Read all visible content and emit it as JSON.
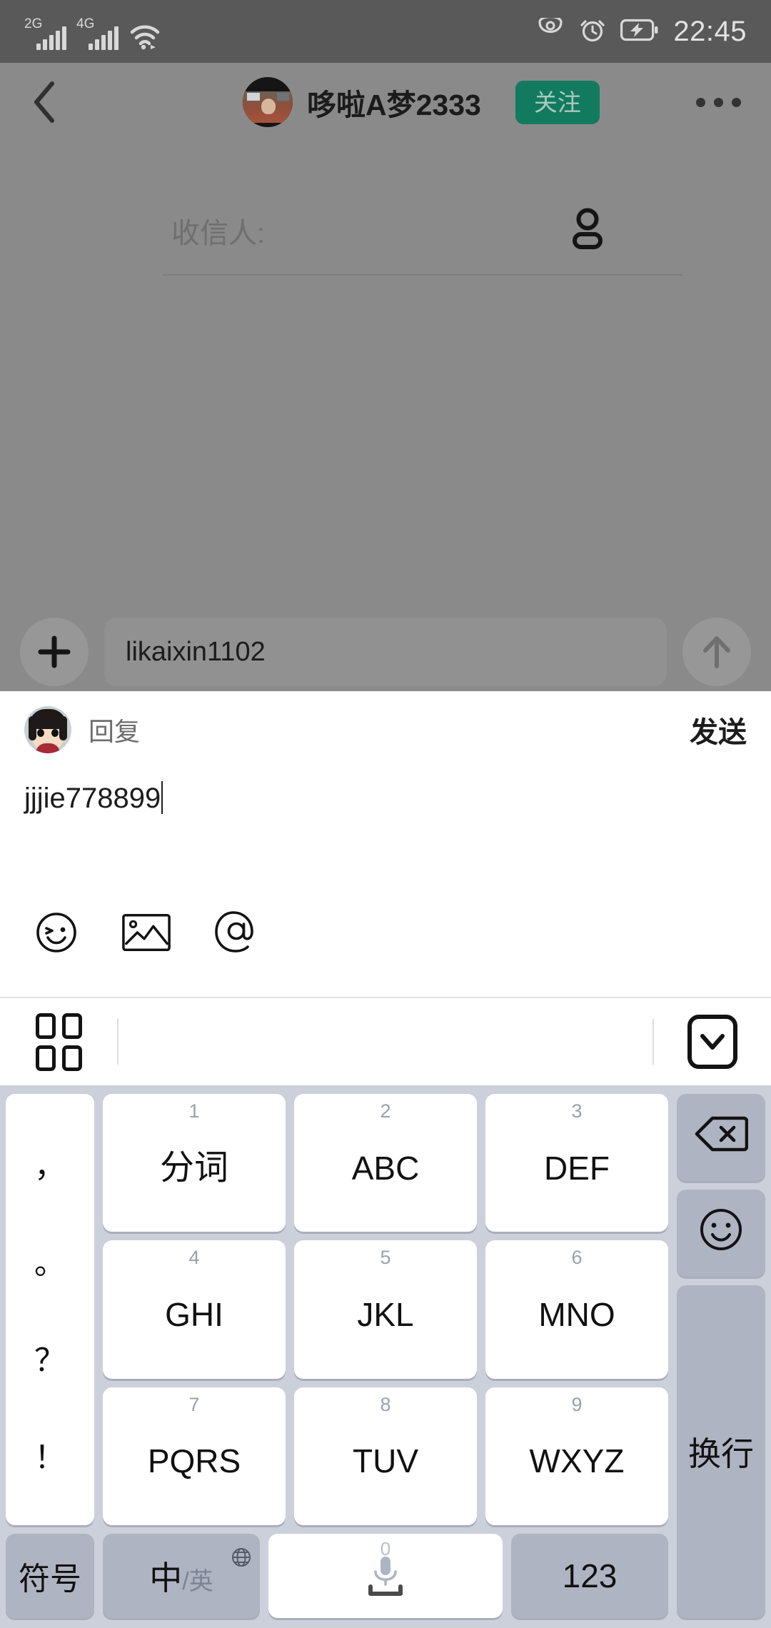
{
  "status_bar": {
    "network_1": "2G",
    "network_2": "4G",
    "wifi_icon": "wifi-icon",
    "eye_icon": "eye-icon",
    "alarm_icon": "alarm-clock-icon",
    "battery_icon": "battery-charging-icon",
    "time": "22:45"
  },
  "background_page": {
    "back_icon": "back-chevron-icon",
    "avatar": "user-avatar",
    "title": "哆啦A梦2333",
    "follow_label": "关注",
    "more_icon": "more-options-icon",
    "recipient_label": "收信人:",
    "recipient_person_icon": "person-icon",
    "composer": {
      "plus_icon": "plus-icon",
      "input_value": "likaixin1102",
      "send_icon": "arrow-up-icon"
    }
  },
  "reply_sheet": {
    "avatar": "reply-user-avatar",
    "label": "回复",
    "send_label": "发送",
    "input_value": "jjjie778899",
    "tools": [
      {
        "name": "emoji-icon",
        "label": "emoji"
      },
      {
        "name": "image-icon",
        "label": "image"
      },
      {
        "name": "mention-icon",
        "label": "@"
      }
    ]
  },
  "keyboard_toolbar": {
    "grid_icon": "grid-menu-icon",
    "hide_icon": "hide-keyboard-icon"
  },
  "keyboard": {
    "punct_key": {
      "name": "punctuation-key",
      "chars": [
        "，",
        "。",
        "？",
        "！"
      ]
    },
    "rows": [
      [
        {
          "num": "1",
          "label": "分词",
          "style": "white",
          "cn": true
        },
        {
          "num": "2",
          "label": "ABC",
          "style": "white",
          "cn": false
        },
        {
          "num": "3",
          "label": "DEF",
          "style": "white",
          "cn": false
        }
      ],
      [
        {
          "num": "4",
          "label": "GHI",
          "style": "white",
          "cn": false
        },
        {
          "num": "5",
          "label": "JKL",
          "style": "white",
          "cn": false
        },
        {
          "num": "6",
          "label": "MNO",
          "style": "white",
          "cn": false
        }
      ],
      [
        {
          "num": "7",
          "label": "PQRS",
          "style": "white",
          "cn": false
        },
        {
          "num": "8",
          "label": "TUV",
          "style": "white",
          "cn": false
        },
        {
          "num": "9",
          "label": "WXYZ",
          "style": "white",
          "cn": false
        }
      ]
    ],
    "right_column": {
      "backspace_icon": "backspace-icon",
      "emoji_icon": "emoji-key-icon",
      "newline_label": "换行"
    },
    "bottom_row": {
      "symbol_label": "符号",
      "lang_cn": "中",
      "lang_en": "/英",
      "globe_icon": "globe-icon",
      "space_num": "0",
      "space_mic_icon": "microphone-icon",
      "numbers_label": "123"
    }
  },
  "colors": {
    "status_bar_bg": "#595959",
    "dim_overlay": "#8a8a8a",
    "follow_green": "#127a5f",
    "keyboard_bg": "#ccd0da",
    "key_gray": "#aeb4c2",
    "key_white": "#ffffff"
  }
}
